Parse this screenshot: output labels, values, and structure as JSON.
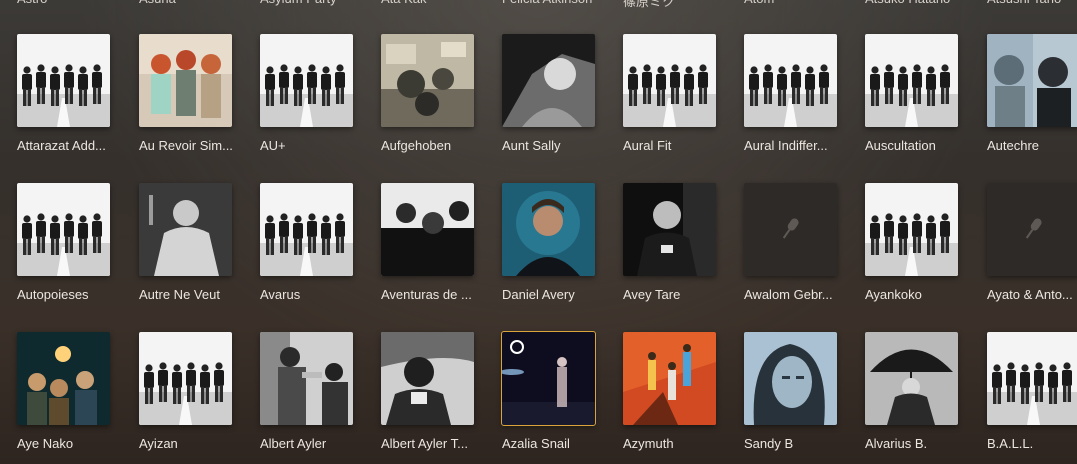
{
  "partial_row_labels": [
    "Astro",
    "Asuna",
    "Asylum Party",
    "Ata Kak",
    "Felicia Atkinson",
    "篠原ミク",
    "Atom",
    "Atsuko Hatano",
    "Atsushi Tano"
  ],
  "rows": [
    [
      {
        "name": "Attarazat Add...",
        "art": "band"
      },
      {
        "name": "Au Revoir Sim...",
        "art": "trio"
      },
      {
        "name": "AU+",
        "art": "band"
      },
      {
        "name": "Aufgehoben",
        "art": "drums"
      },
      {
        "name": "Aunt Sally",
        "art": "bw-portrait"
      },
      {
        "name": "Aural Fit",
        "art": "band"
      },
      {
        "name": "Aural Indiffer...",
        "art": "band"
      },
      {
        "name": "Auscultation",
        "art": "band"
      },
      {
        "name": "Autechre",
        "art": "duo-blue"
      }
    ],
    [
      {
        "name": "Autopoieses",
        "art": "band"
      },
      {
        "name": "Autre Ne Veut",
        "art": "singer-bw"
      },
      {
        "name": "Avarus",
        "art": "band"
      },
      {
        "name": "Aventuras de ...",
        "art": "trio-bw"
      },
      {
        "name": "Daniel Avery",
        "art": "teal-portrait"
      },
      {
        "name": "Avey Tare",
        "art": "dark-portrait"
      },
      {
        "name": "Awalom Gebr...",
        "art": "placeholder"
      },
      {
        "name": "Ayankoko",
        "art": "band"
      },
      {
        "name": "Ayato & Anto...",
        "art": "placeholder"
      }
    ],
    [
      {
        "name": "Aye Nako",
        "art": "group-color"
      },
      {
        "name": "Ayizan",
        "art": "band"
      },
      {
        "name": "Albert Ayler",
        "art": "sax-bw"
      },
      {
        "name": "Albert Ayler T...",
        "art": "man-bw"
      },
      {
        "name": "Azalia Snail",
        "art": "night",
        "selected": true
      },
      {
        "name": "Azymuth",
        "art": "orange-trio"
      },
      {
        "name": "Sandy B",
        "art": "blue-woman"
      },
      {
        "name": "Alvarius B.",
        "art": "umbrella"
      },
      {
        "name": "B.A.L.L.",
        "art": "band"
      }
    ]
  ],
  "colors": {
    "selected_outline": "#d9a43c",
    "placeholder_bg": "#2e2a27",
    "label_text": "#ece6e0"
  },
  "icons": {
    "placeholder": "microphone-icon",
    "selection": "selection-circle-icon"
  }
}
